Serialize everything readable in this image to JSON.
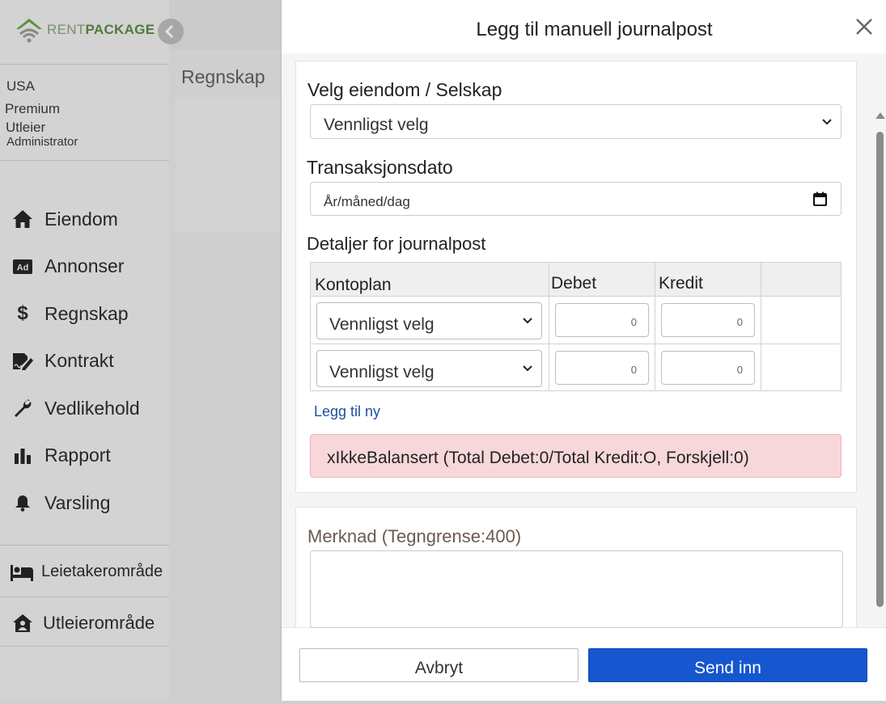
{
  "sidebar": {
    "logo": {
      "part1": "RENT",
      "part2": "PACKAGE"
    },
    "user": {
      "country": "USA",
      "plan": "Premium",
      "role": "Utleier",
      "access": "Administrator"
    },
    "menu": [
      {
        "label": "Eiendom",
        "icon": "home-icon"
      },
      {
        "label": "Annonser",
        "icon": "ad-icon"
      },
      {
        "label": "Regnskap",
        "icon": "dollar-icon"
      },
      {
        "label": "Kontrakt",
        "icon": "contract-icon"
      },
      {
        "label": "Vedlikehold",
        "icon": "wrench-icon"
      },
      {
        "label": "Rapport",
        "icon": "bar-chart-icon"
      },
      {
        "label": "Varsling",
        "icon": "bell-icon"
      }
    ],
    "tenant_area": "Leietakerområde",
    "landlord_area": "Utleierområde"
  },
  "background": {
    "page_title": "Regnskap"
  },
  "modal": {
    "title": "Legg til manuell journalpost",
    "property_label": "Velg eiendom / Selskap",
    "property_value": "Vennligst velg",
    "date_label": "Transaksjonsdato",
    "date_placeholder": "År/måned/dag",
    "details_label": "Detaljer for journalpost",
    "table": {
      "headers": {
        "account": "Kontoplan",
        "debit": "Debet",
        "credit": "Kredit"
      },
      "rows": [
        {
          "account": "Vennligst velg",
          "debit": "0",
          "credit": "0"
        },
        {
          "account": "Vennligst velg",
          "debit": "0",
          "credit": "0"
        }
      ]
    },
    "add_link": "Legg til ny",
    "alert": "xIkkeBalansert (Total Debet:0/Total Kredit:O, Forskjell:0)",
    "note_label": "Merknad (Tegngrense:400)",
    "cancel": "Avbryt",
    "submit": "Send inn"
  },
  "colors": {
    "brand_green": "#4f7b3a",
    "submit_blue": "#1657cf",
    "alert_bg": "#f8d7da",
    "link_blue": "#1f4fa1"
  }
}
